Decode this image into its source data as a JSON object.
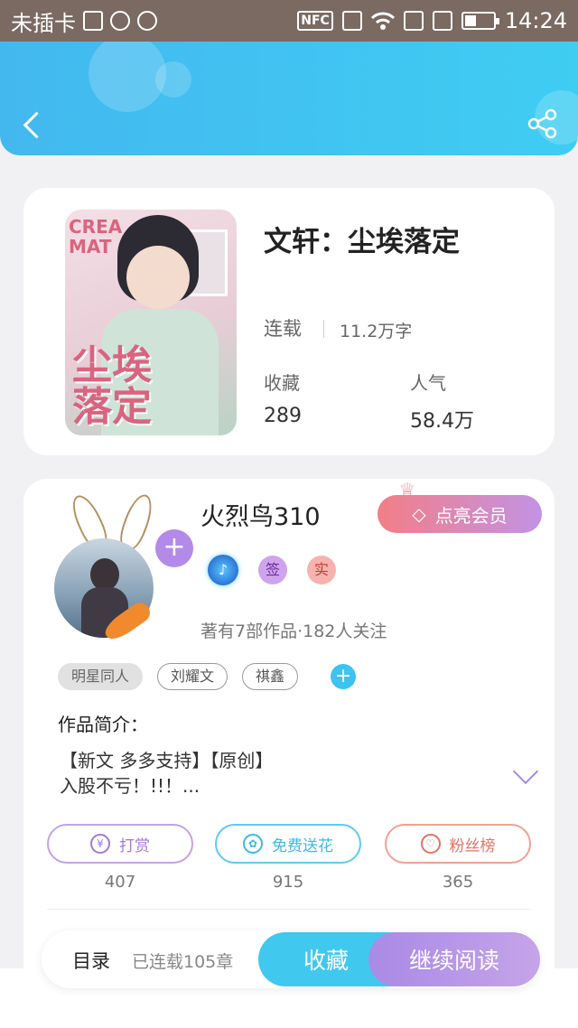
{
  "status_bar": {
    "carrier": "未插卡",
    "nfc": "NFC",
    "time": "14:24"
  },
  "header": {
    "back_icon": "back-arrow-icon",
    "share_icon": "share-icon",
    "accent_color": "#43b8ef"
  },
  "book": {
    "title": "文轩：尘埃落定",
    "cover_text_top": "CREA\nMAT",
    "cover_text_title": "尘埃\n落定",
    "status": "连载",
    "word_count": "11.2万字",
    "fav_label": "收藏",
    "fav_value": "289",
    "pop_label": "人气",
    "pop_value": "58.4万"
  },
  "author": {
    "name": "火烈鸟310",
    "vip_button": "点亮会员",
    "badge_sign": "签",
    "badge_real": "实",
    "meta": "著有7部作品·182人关注",
    "tags": [
      "明星同人",
      "刘耀文",
      "祺鑫"
    ],
    "intro_title": "作品简介：",
    "intro_text": "【新文 多多支持】【原创】\n入股不亏！!!！..."
  },
  "actions": {
    "reward_label": "打赏",
    "reward_count": "407",
    "flower_label": "免费送花",
    "flower_count": "915",
    "fans_label": "粉丝榜",
    "fans_count": "365"
  },
  "bottom": {
    "toc_label": "目录",
    "toc_count": "已连载105章",
    "fav_button": "收藏",
    "read_button": "继续阅读"
  }
}
